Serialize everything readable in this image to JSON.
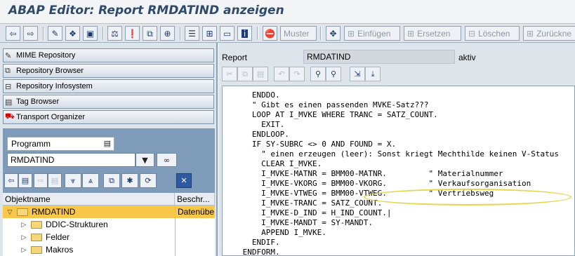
{
  "window": {
    "title": "ABAP Editor: Report RMDATIND anzeigen"
  },
  "toolbar": {
    "icons": [
      "back-arrow-icon",
      "forward-arrow-icon",
      "display-change-icon",
      "active-inactive-icon",
      "other-object-icon",
      "check-icon",
      "activate-icon",
      "test-icon",
      "where-used-icon",
      "object-list-icon",
      "worklist-icon",
      "info-icon",
      "breakpoint-icon"
    ],
    "muster_label": "Muster",
    "insert_label": "Einfügen",
    "replace_label": "Ersetzen",
    "delete_label": "Löschen",
    "undo_label": "Zurückne"
  },
  "navigator": {
    "items": [
      {
        "label": "MIME Repository",
        "icon": "mime-icon"
      },
      {
        "label": "Repository Browser",
        "icon": "repository-browser-icon"
      },
      {
        "label": "Repository Infosystem",
        "icon": "infosystem-icon"
      },
      {
        "label": "Tag Browser",
        "icon": "tag-icon"
      },
      {
        "label": "Transport Organizer",
        "icon": "transport-icon"
      }
    ],
    "object_type": "Programm",
    "object_name": "RMDATIND",
    "tree_header": {
      "col_name": "Objektname",
      "col_desc": "Beschr..."
    },
    "tree": [
      {
        "label": "RMDATIND",
        "desc": "Datenübe",
        "expanded": true,
        "selected": true,
        "level": 0
      },
      {
        "label": "DDIC-Strukturen",
        "desc": "",
        "expanded": false,
        "selected": false,
        "level": 1
      },
      {
        "label": "Felder",
        "desc": "",
        "expanded": false,
        "selected": false,
        "level": 1
      },
      {
        "label": "Makros",
        "desc": "",
        "expanded": false,
        "selected": false,
        "level": 1
      }
    ]
  },
  "editor": {
    "report_label": "Report",
    "report_name": "RMDATIND",
    "status": "aktiv",
    "lines": [
      "   ENDDO.",
      "   \" Gibt es einen passenden MVKE-Satz???",
      "   LOOP AT I_MVKE WHERE TRANC = SATZ_COUNT.",
      "     EXIT.",
      "   ENDLOOP.",
      "   IF SY-SUBRC <> 0 AND FOUND = X.",
      "     \" einen erzeugen (leer): Sonst kriegt Mechthilde keinen V-Status",
      "     CLEAR I_MVKE.",
      "     I_MVKE-MATNR = BMM00-MATNR.         \" Materialnummer",
      "     I_MVKE-VKORG = BMM00-VKORG.         \" Verkaufsorganisation",
      "     I_MVKE-VTWEG = BMM00-VTWEG.         \" Vertriebsweg",
      "     I_MVKE-TRANC = SATZ_COUNT.",
      "     I_MVKE-D_IND = H_IND_COUNT.|",
      "     I_MVKE-MANDT = SY-MANDT.",
      "     APPEND I_MVKE.",
      "   ENDIF.",
      " ENDFORM."
    ]
  }
}
